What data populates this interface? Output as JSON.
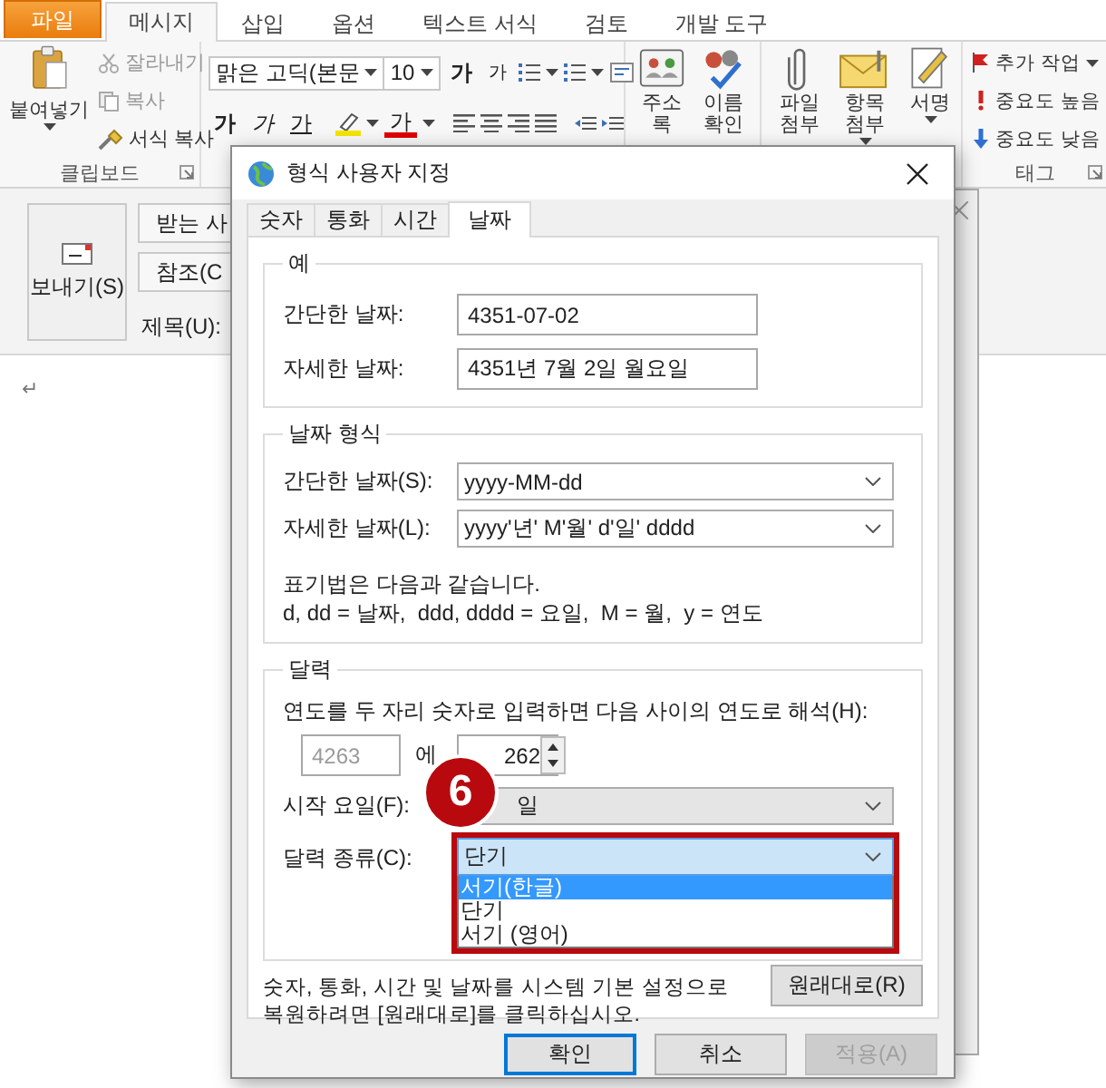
{
  "ribbon": {
    "tabs": [
      {
        "label": "파일",
        "kind": "file",
        "selected": false
      },
      {
        "label": "메시지",
        "kind": "tab",
        "selected": true
      },
      {
        "label": "삽입",
        "kind": "tab",
        "selected": false
      },
      {
        "label": "옵션",
        "kind": "tab",
        "selected": false
      },
      {
        "label": "텍스트 서식",
        "kind": "tab",
        "selected": false
      },
      {
        "label": "검토",
        "kind": "tab",
        "selected": false
      },
      {
        "label": "개발 도구",
        "kind": "tab",
        "selected": false
      }
    ],
    "clipboard": {
      "label": "클립보드",
      "paste": "붙여넣기",
      "items": [
        {
          "label": "잘라내기",
          "disabled": true
        },
        {
          "label": "복사",
          "disabled": true
        },
        {
          "label": "서식 복사",
          "disabled": false
        }
      ]
    },
    "font": {
      "font_name": "맑은 고딕(본문",
      "font_size": "10",
      "grow": "가",
      "shrink": "가",
      "bold": "가",
      "italic": "가",
      "underline": "가",
      "font_color": "가"
    },
    "names": [
      {
        "label": "주소록"
      },
      {
        "label": "이름 확인"
      }
    ],
    "include": [
      {
        "label": "파일 첨부",
        "dropdown": false
      },
      {
        "label": "항목 첨부",
        "dropdown": true
      },
      {
        "label": "서명",
        "dropdown": true
      }
    ],
    "tags": {
      "label": "태그",
      "items": [
        {
          "label": "추가 작업",
          "dropdown": true
        },
        {
          "label": "중요도 높음",
          "dropdown": false
        },
        {
          "label": "중요도 낮음",
          "dropdown": false
        }
      ]
    }
  },
  "compose": {
    "send": "보내기(S)",
    "to": "받는 사",
    "cc": "참조(C",
    "subject": "제목(U):",
    "paragraph_mark": "↵"
  },
  "dialog": {
    "title": "형식 사용자 지정",
    "tabs": [
      {
        "label": "숫자",
        "selected": false
      },
      {
        "label": "통화",
        "selected": false
      },
      {
        "label": "시간",
        "selected": false
      },
      {
        "label": "날짜",
        "selected": true
      }
    ],
    "example": {
      "title": "예",
      "rows": [
        {
          "label": "간단한 날짜:",
          "value": "4351-07-02"
        },
        {
          "label": "자세한 날짜:",
          "value": "4351년 7월 2일 월요일"
        }
      ]
    },
    "format": {
      "title": "날짜 형식",
      "rows": [
        {
          "label": "간단한 날짜(S):",
          "value": "yyyy-MM-dd"
        },
        {
          "label": "자세한 날짜(L):",
          "value": "yyyy'년' M'월' d'일' dddd"
        }
      ],
      "notation_title": "표기법은 다음과 같습니다.",
      "notation": "d, dd = 날짜,  ddd, dddd = 요일,  M = 월,  y = 연도"
    },
    "calendar": {
      "title": "달력",
      "two_digit_label": "연도를 두 자리 숫자로 입력하면 다음 사이의 연도로 해석(H):",
      "year_from": "4263",
      "between": "에",
      "year_to": "262",
      "first_day": {
        "label": "시작 요일(F):",
        "value": "일"
      },
      "calendar_type": {
        "label": "달력 종류(C):",
        "value": "단기",
        "expanded": true,
        "options": [
          {
            "label": "서기(한글)",
            "highlighted": true
          },
          {
            "label": "단기",
            "highlighted": false
          },
          {
            "label": "서기 (영어)",
            "highlighted": false
          }
        ]
      }
    },
    "restore_text": "숫자, 통화, 시간 및 날짜를 시스템 기본 설정으로 복원하려면 [원래대로]를 클릭하십시오.",
    "restore_button": "원래대로(R)",
    "buttons": [
      {
        "label": "확인",
        "kind": "default",
        "disabled": false
      },
      {
        "label": "취소",
        "kind": "normal",
        "disabled": false
      },
      {
        "label": "적용(A)",
        "kind": "normal",
        "disabled": true
      }
    ]
  },
  "callout": {
    "number": "6"
  }
}
